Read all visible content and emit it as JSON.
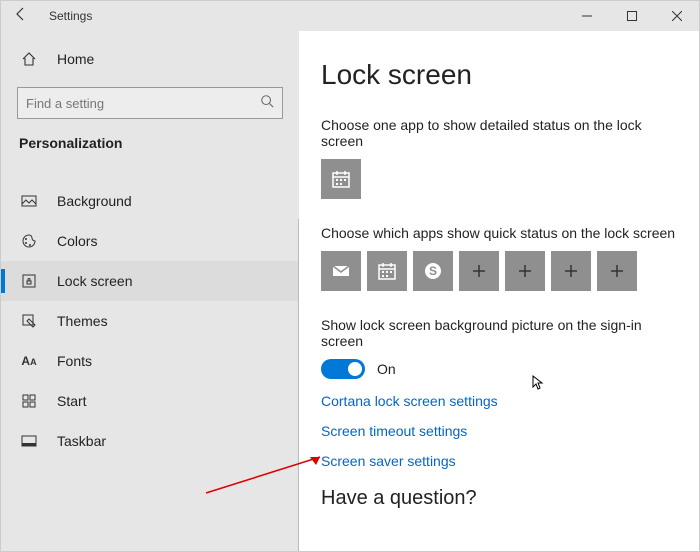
{
  "window": {
    "title": "Settings"
  },
  "sidebar": {
    "home": "Home",
    "search_placeholder": "Find a setting",
    "category": "Personalization",
    "items": [
      {
        "label": "Background"
      },
      {
        "label": "Colors"
      },
      {
        "label": "Lock screen"
      },
      {
        "label": "Themes"
      },
      {
        "label": "Fonts"
      },
      {
        "label": "Start"
      },
      {
        "label": "Taskbar"
      }
    ]
  },
  "main": {
    "heading": "Lock screen",
    "detailed_label": "Choose one app to show detailed status on the lock screen",
    "quick_label": "Choose which apps show quick status on the lock screen",
    "toggle_label": "Show lock screen background picture on the sign-in screen",
    "toggle_state": "On",
    "links": {
      "cortana": "Cortana lock screen settings",
      "timeout": "Screen timeout settings",
      "saver": "Screen saver settings"
    },
    "question_heading": "Have a question?"
  }
}
